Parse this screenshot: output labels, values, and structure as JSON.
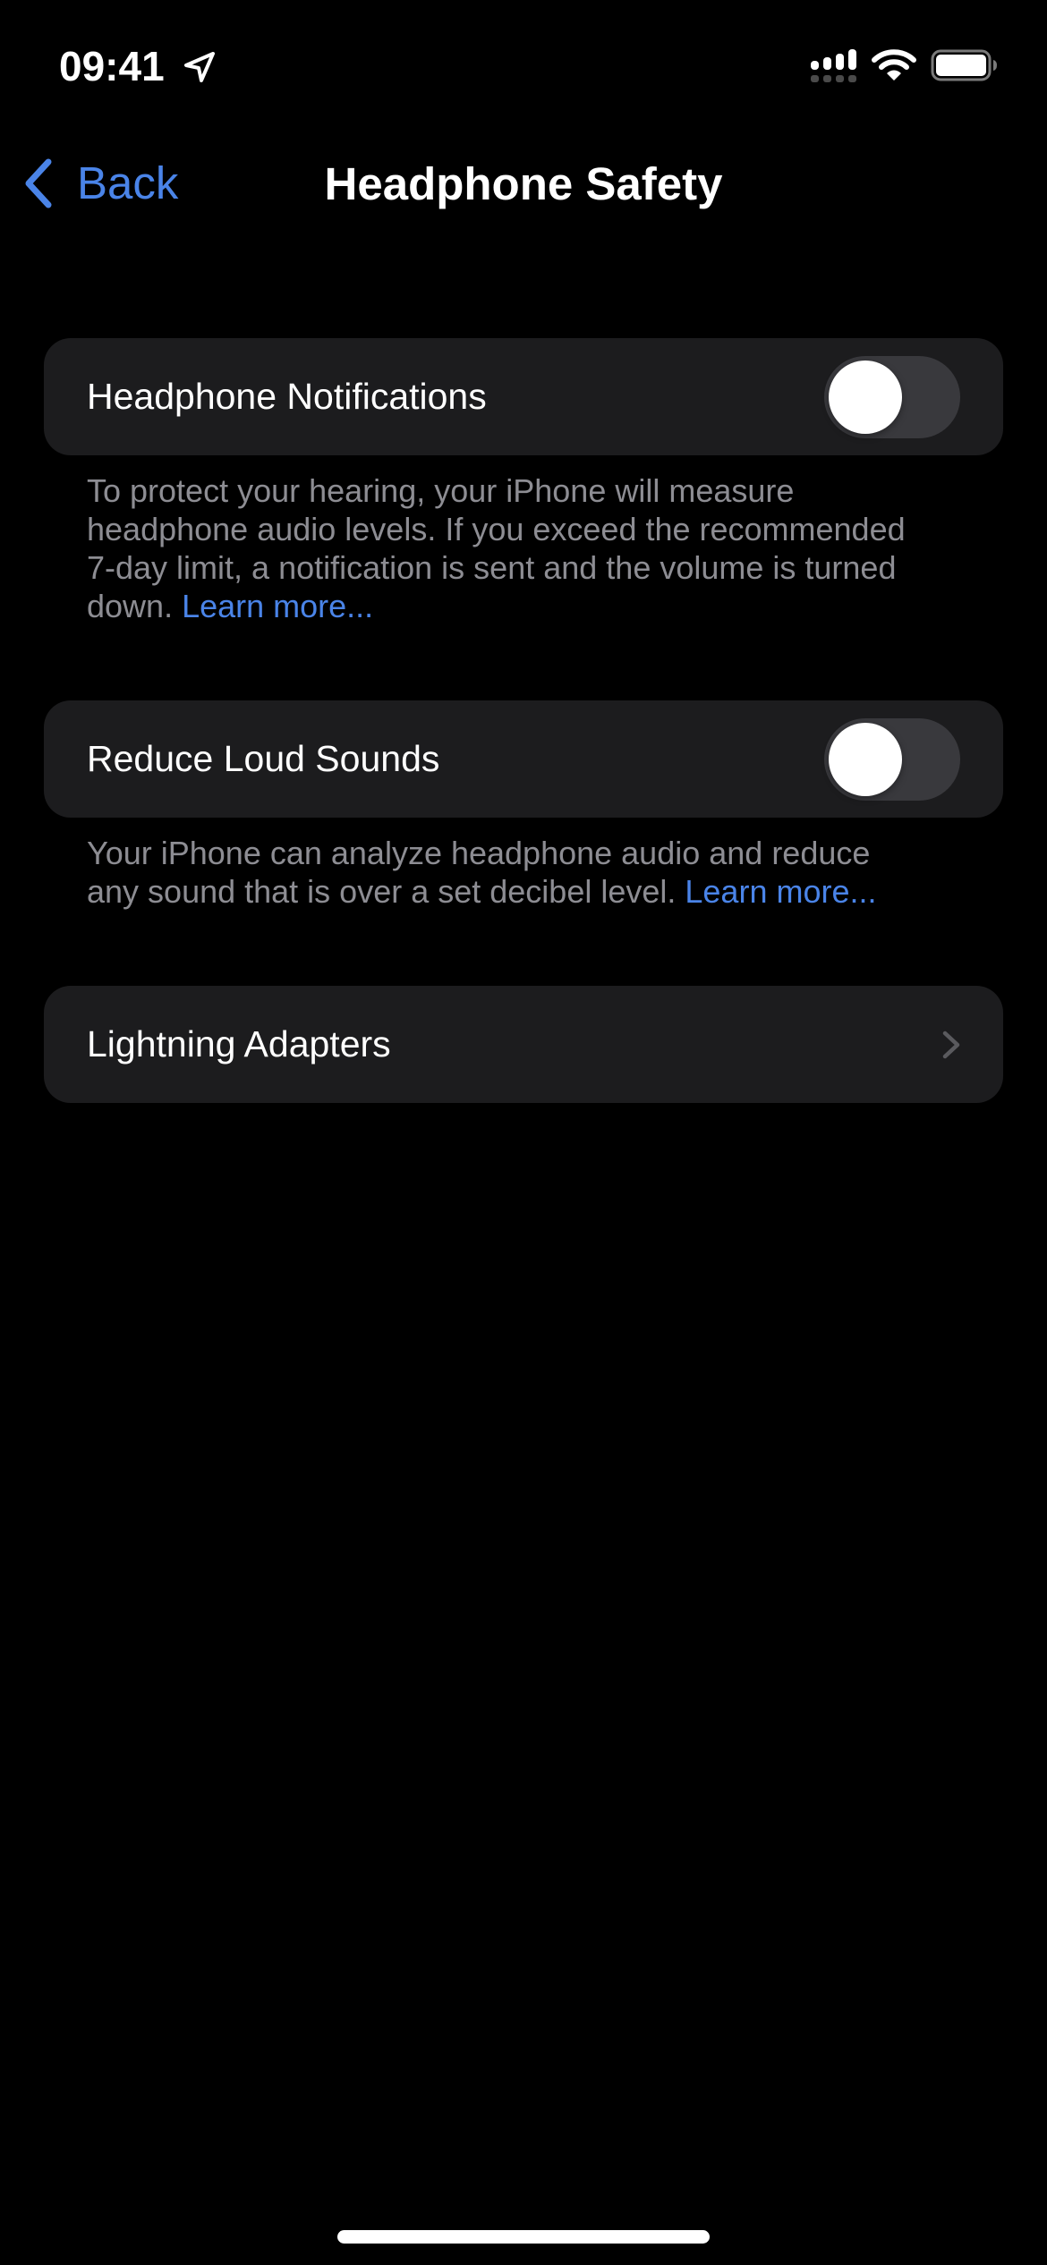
{
  "status_bar": {
    "time": "09:41",
    "icons": [
      "location-arrow-icon",
      "cellular-signal-icon",
      "wifi-icon",
      "battery-icon"
    ]
  },
  "nav": {
    "back_label": "Back",
    "title": "Headphone Safety"
  },
  "settings": {
    "headphone_notifications": {
      "label": "Headphone Notifications",
      "enabled": false,
      "footer_lines": [
        "To protect your hearing, your iPhone will measure",
        "headphone audio levels. If you exceed the recommended",
        "7-day limit, a notification is sent and the volume is turned"
      ],
      "footer_last_prefix": "down. ",
      "footer_link": "Learn more..."
    },
    "reduce_loud_sounds": {
      "label": "Reduce Loud Sounds",
      "enabled": false,
      "footer_lines": [
        "Your iPhone can analyze headphone audio and reduce"
      ],
      "footer_last_prefix": "any sound that is over a set decibel level. ",
      "footer_link": "Learn more..."
    },
    "lightning_adapters": {
      "label": "Lightning Adapters",
      "accessory": "chevron-right-icon"
    }
  },
  "colors": {
    "accent": "#4A84E8",
    "background": "#000000",
    "cell_background": "#1C1C1E",
    "toggle_off": "#39393D",
    "secondary_text": "#8D8D93"
  }
}
